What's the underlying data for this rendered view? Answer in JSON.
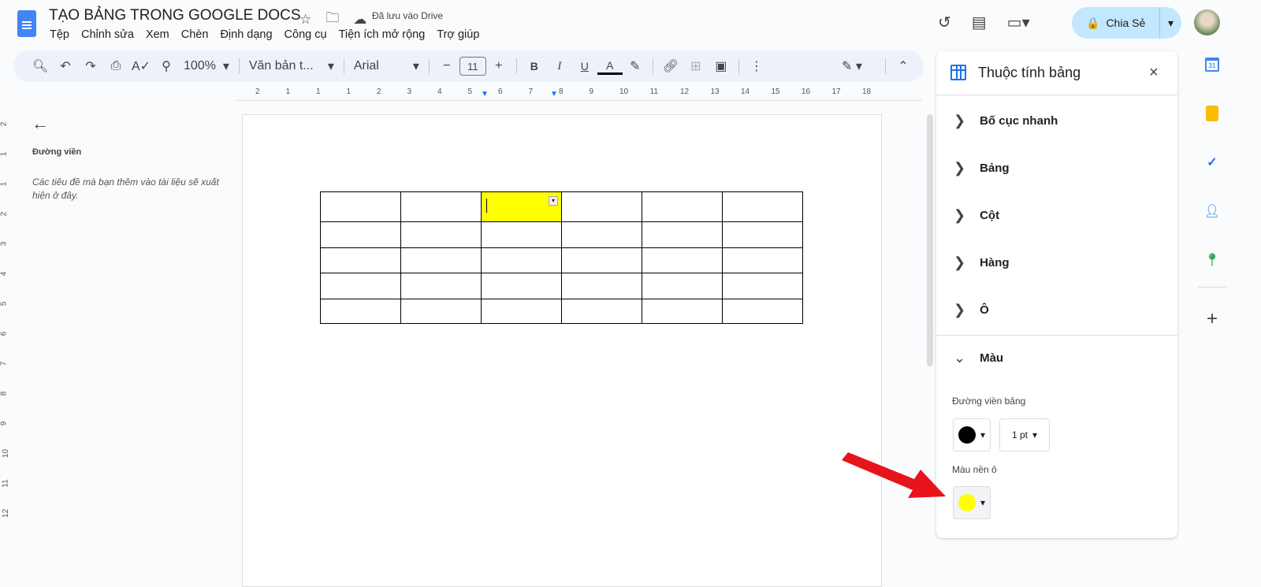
{
  "header": {
    "title": "TẠO BẢNG TRONG GOOGLE DOCS",
    "saved_status": "Đã lưu vào Drive",
    "share_label": "Chia Sẻ"
  },
  "menu": [
    "Tệp",
    "Chỉnh sửa",
    "Xem",
    "Chèn",
    "Định dạng",
    "Công cụ",
    "Tiện ích mở rộng",
    "Trợ giúp"
  ],
  "toolbar": {
    "zoom": "100%",
    "style": "Văn bản t...",
    "font": "Arial",
    "font_size": "11",
    "bold": "B",
    "italic": "I",
    "underline": "U",
    "text_color": "A"
  },
  "ruler": {
    "h": [
      "2",
      "1",
      "1",
      "1",
      "2",
      "3",
      "4",
      "5",
      "6",
      "7",
      "8",
      "9",
      "10",
      "11",
      "12",
      "13",
      "14",
      "15",
      "16",
      "17",
      "18"
    ],
    "v": [
      "2",
      "1",
      "1",
      "2",
      "3",
      "4",
      "5",
      "6",
      "7",
      "8",
      "9",
      "10",
      "11",
      "12"
    ]
  },
  "outline": {
    "heading": "Đường viền",
    "hint": "Các tiêu đề mà bạn thêm vào tài liệu sẽ xuất hiện ở đây."
  },
  "panel": {
    "title": "Thuộc tính bảng",
    "sections": [
      "Bố cục nhanh",
      "Bảng",
      "Cột",
      "Hàng",
      "Ô",
      "Màu"
    ],
    "border_label": "Đường viền bảng",
    "border_width": "1 pt",
    "bg_label": "Màu nền ô",
    "border_color": "#000000",
    "bg_color": "#ffff00"
  },
  "table": {
    "rows": 5,
    "cols": 6,
    "highlight_color": "#ffff00"
  }
}
